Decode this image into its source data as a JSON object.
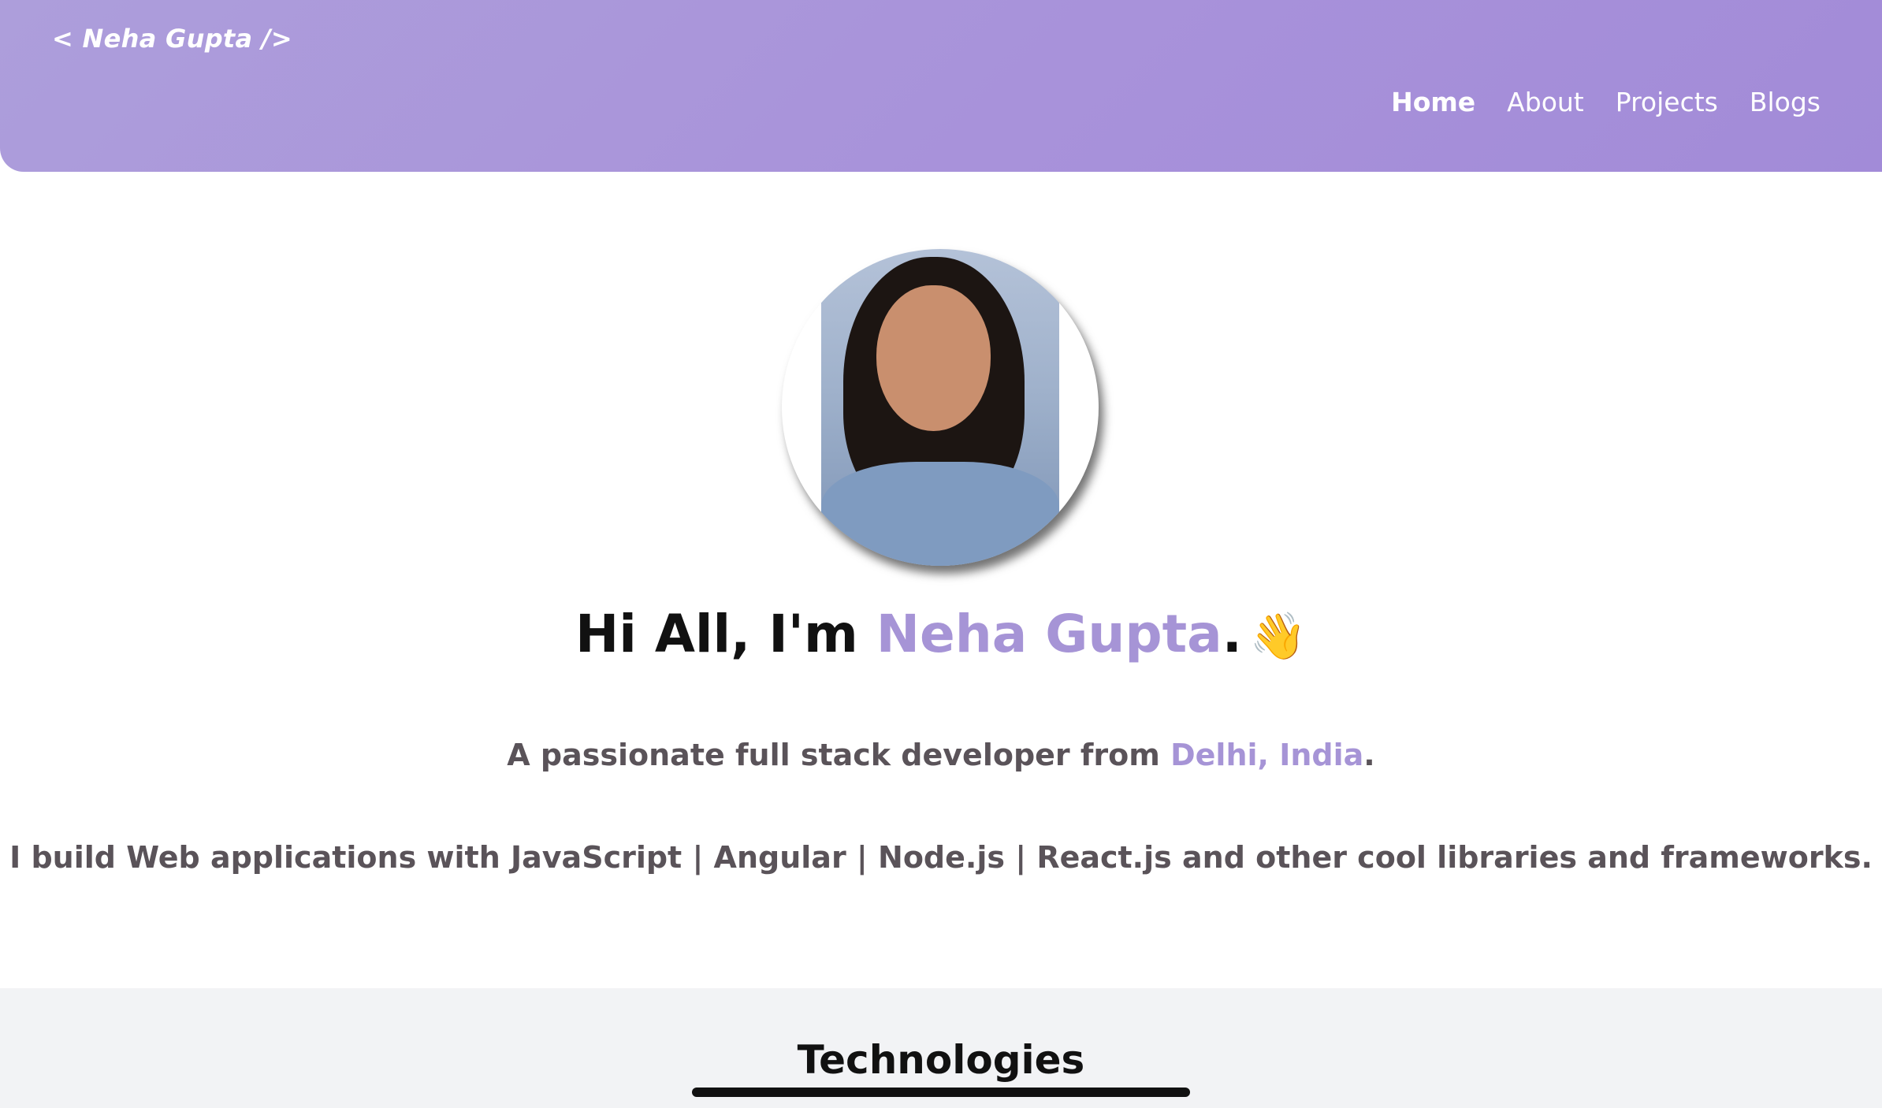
{
  "header": {
    "logo": "< Neha Gupta />",
    "nav": [
      {
        "label": "Home",
        "active": true
      },
      {
        "label": "About",
        "active": false
      },
      {
        "label": "Projects",
        "active": false
      },
      {
        "label": "Blogs",
        "active": false
      }
    ]
  },
  "hero": {
    "greeting_prefix": "Hi All, I'm ",
    "greeting_name": "Neha Gupta",
    "greeting_suffix": ".",
    "greeting_emoji": "👋",
    "tagline_prefix": "A passionate full stack developer from ",
    "tagline_location": "Delhi, India",
    "tagline_suffix": ".",
    "skills_text": "I build Web applications with JavaScript | Angular | Node.js | React.js and other cool libraries and frameworks."
  },
  "technologies": {
    "title": "Technologies"
  },
  "colors": {
    "header": "#a892da",
    "accent": "#a694d6",
    "body_text": "#5a5359",
    "section_bg": "#f2f3f5"
  }
}
